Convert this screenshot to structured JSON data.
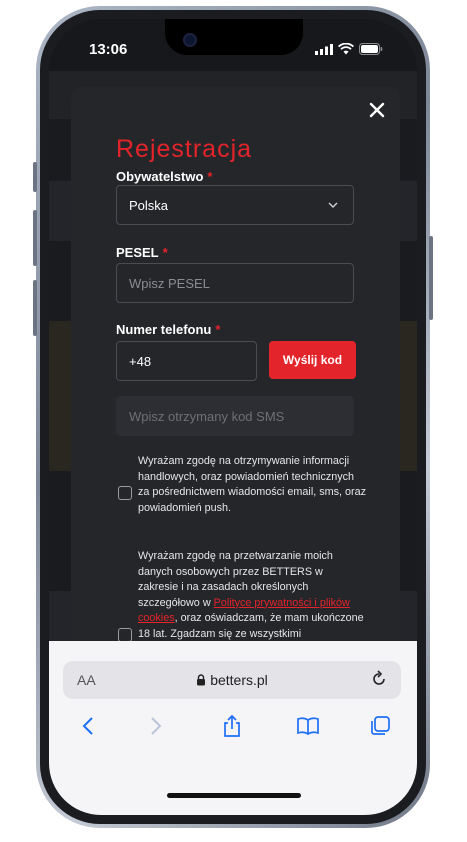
{
  "status_bar": {
    "time": "13:06"
  },
  "modal": {
    "title": "Rejestracja",
    "required_mark": "*",
    "citizenship": {
      "label": "Obywatelstwo",
      "value": "Polska"
    },
    "pesel": {
      "label": "PESEL",
      "placeholder": "Wpisz PESEL"
    },
    "phone": {
      "label": "Numer telefonu",
      "prefix": "+48",
      "send_code_label": "Wyślij kod"
    },
    "sms_code": {
      "placeholder": "Wpisz otrzymany kod SMS"
    },
    "consent_marketing": "Wyrażam zgodę na otrzymywanie informacji handlowych, oraz powiadomień technicznych za pośrednictwem wiadomości email, sms, oraz powiadomień push.",
    "consent_data": {
      "text_before": "Wyrażam zgodę na przetwarzanie moich danych osobowych przez BETTERS w zakresie i na zasadach określonych szczegółowo w",
      "link": "Polityce prywatności i plików cookies",
      "text_after": ", oraz oświadczam, że mam ukończone 18 lat. Zgadzam się ze wszystkimi postanowieniami"
    }
  },
  "browser": {
    "text_size_label": "AA",
    "url": "betters.pl"
  },
  "colors": {
    "accent": "#e3242b",
    "modal_bg": "#25262a"
  },
  "icons": [
    "close-icon",
    "chevron-down-icon",
    "lock-icon",
    "reload-icon",
    "back-icon",
    "forward-icon",
    "share-icon",
    "bookmarks-icon",
    "tabs-icon",
    "signal-icon",
    "wifi-icon",
    "battery-icon"
  ]
}
